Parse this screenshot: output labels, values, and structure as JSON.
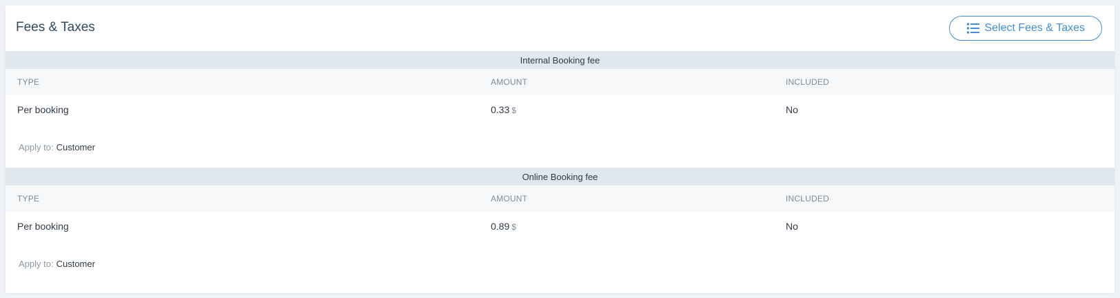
{
  "header": {
    "title": "Fees & Taxes",
    "select_button_label": "Select Fees & Taxes",
    "select_button_icon": "list-icon"
  },
  "columns": {
    "type": "TYPE",
    "amount": "AMOUNT",
    "included": "INCLUDED"
  },
  "fees": [
    {
      "name": "Internal Booking fee",
      "type": "Per booking",
      "amount": "0.33",
      "currency": "$",
      "included": "No",
      "apply_label": "Apply to:",
      "apply_value": "Customer"
    },
    {
      "name": "Online Booking fee",
      "type": "Per booking",
      "amount": "0.89",
      "currency": "$",
      "included": "No",
      "apply_label": "Apply to:",
      "apply_value": "Customer"
    }
  ],
  "colors": {
    "accent": "#3d8fd9",
    "title": "#2e4a62",
    "section_bar": "#e1e7ee"
  }
}
